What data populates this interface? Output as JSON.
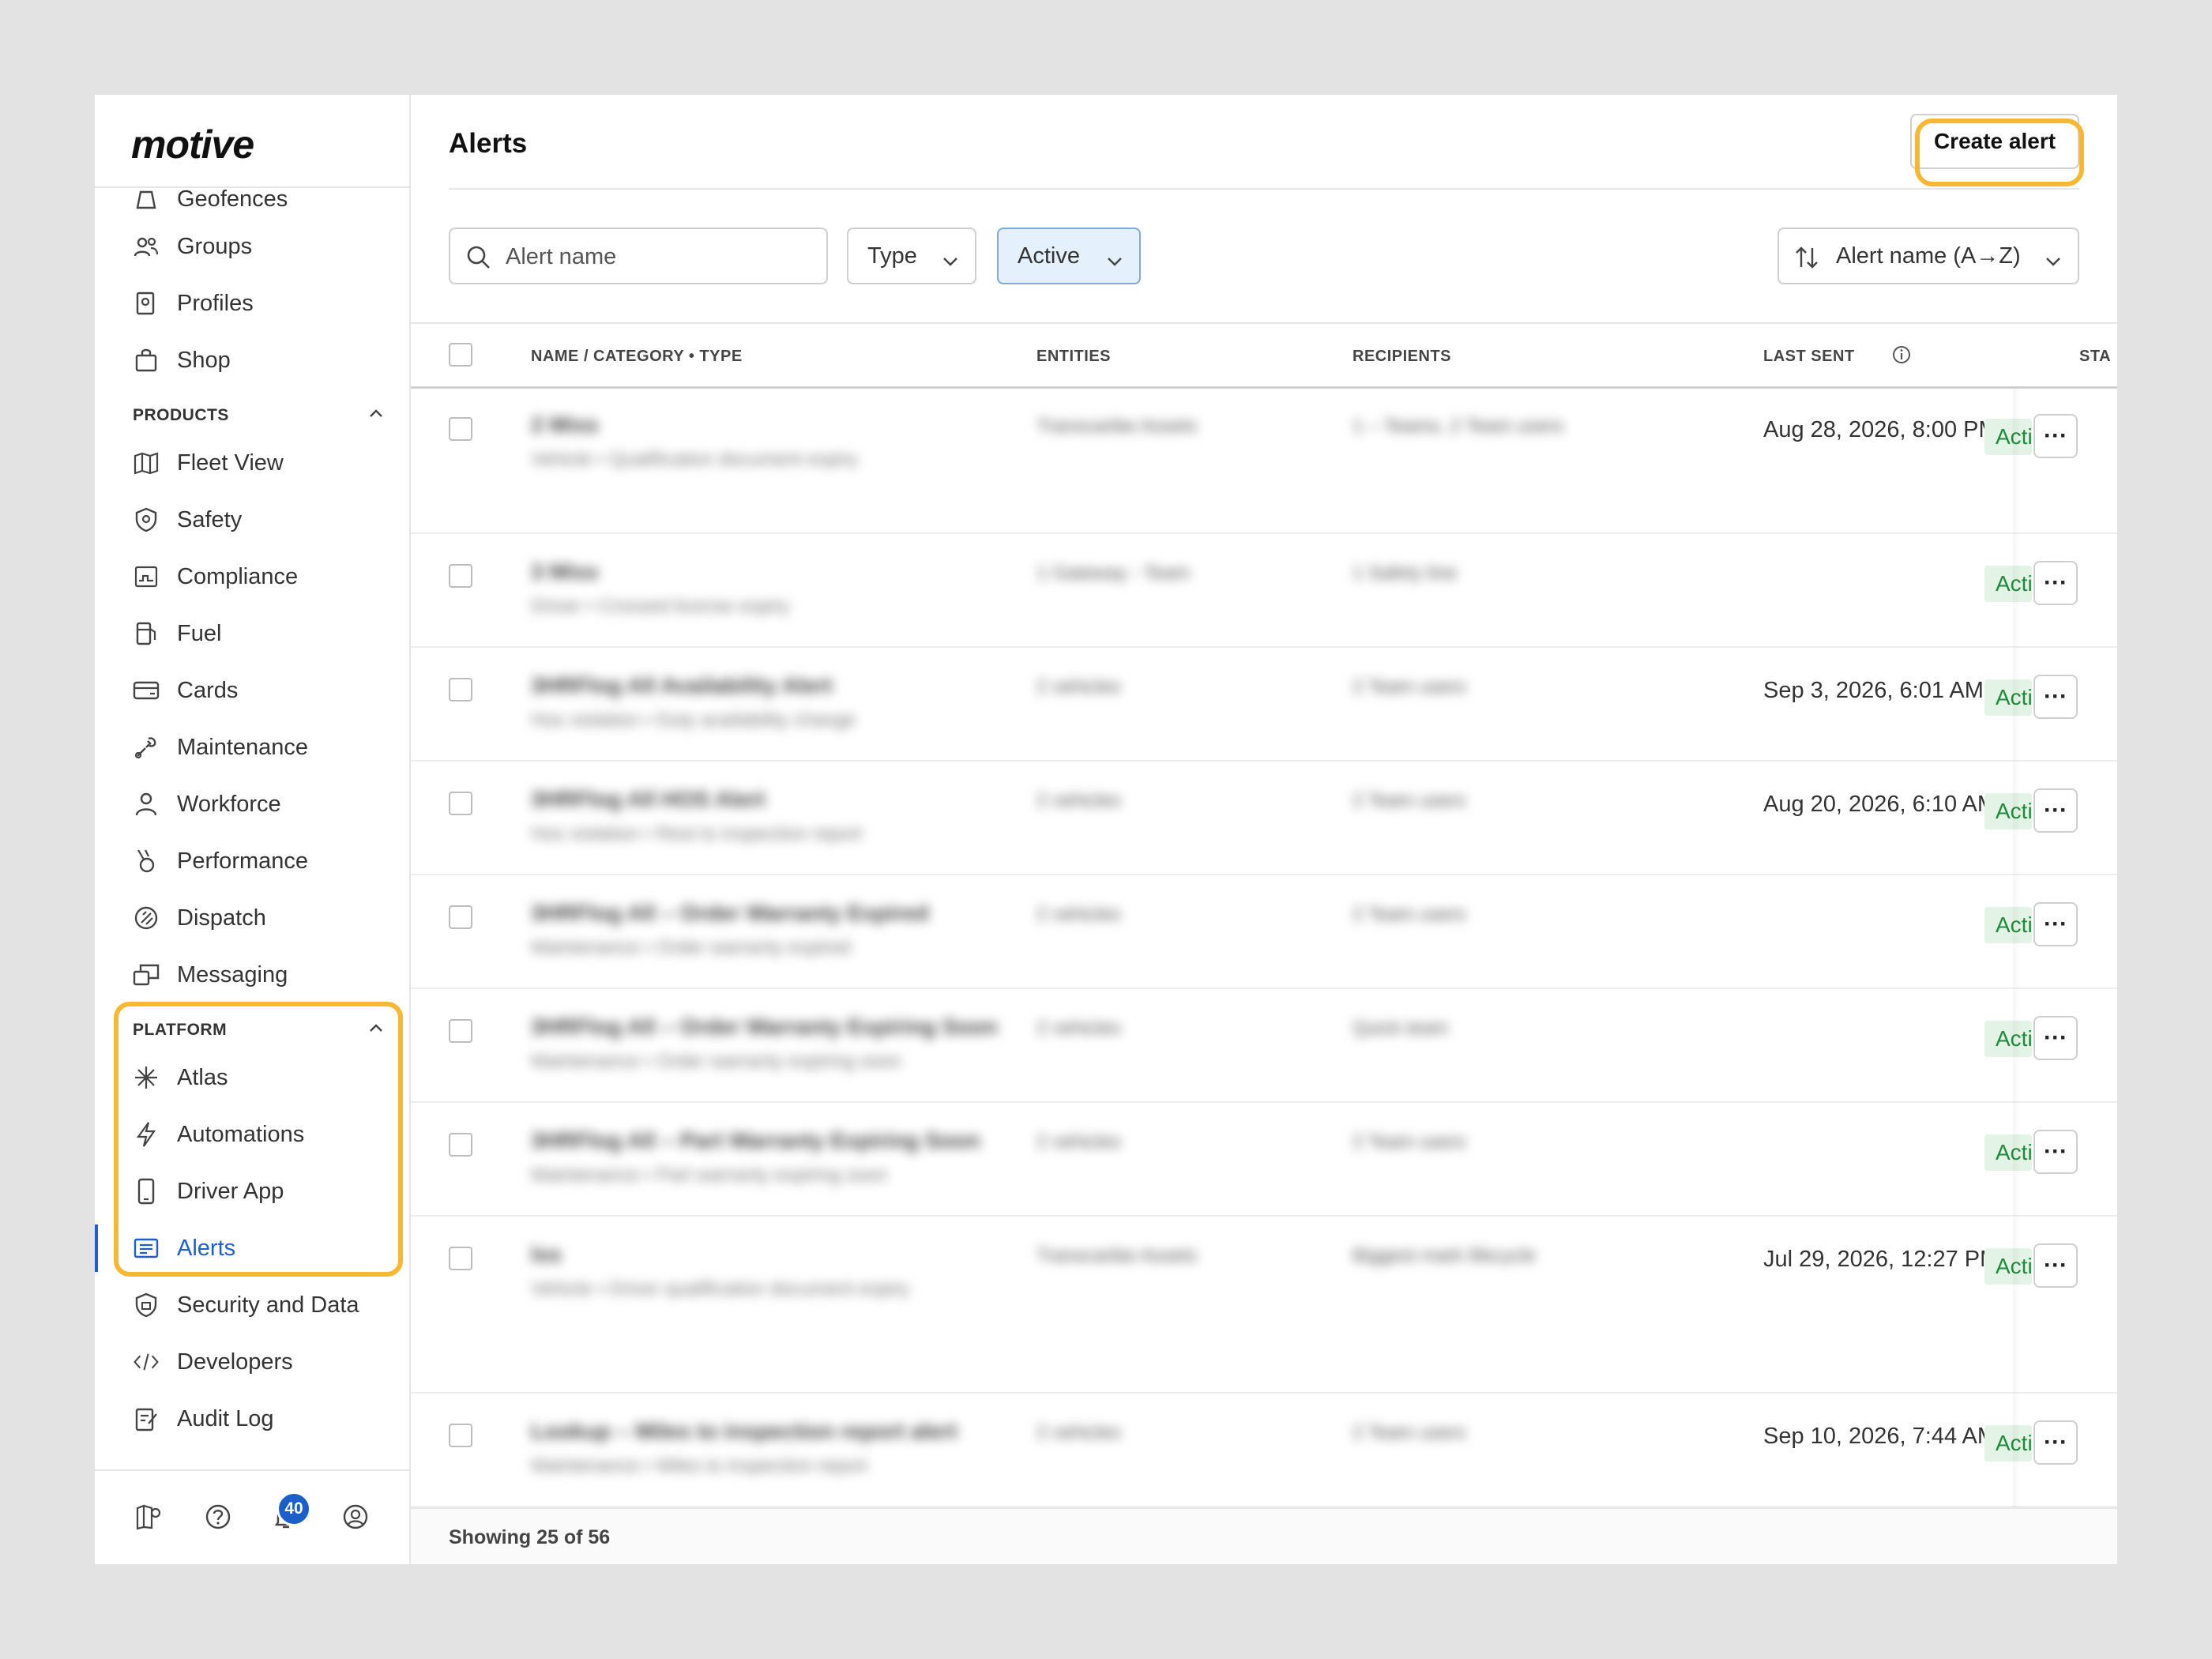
{
  "brand": {
    "logo": "motive"
  },
  "sidebar": {
    "top_items": [
      {
        "label": "Geofences",
        "icon": "geofence-icon"
      },
      {
        "label": "Groups",
        "icon": "groups-icon"
      },
      {
        "label": "Profiles",
        "icon": "profiles-icon"
      },
      {
        "label": "Shop",
        "icon": "shop-icon"
      }
    ],
    "products_label": "PRODUCTS",
    "products": [
      {
        "label": "Fleet View",
        "icon": "map-icon"
      },
      {
        "label": "Safety",
        "icon": "shield-icon"
      },
      {
        "label": "Compliance",
        "icon": "compliance-icon"
      },
      {
        "label": "Fuel",
        "icon": "fuel-icon"
      },
      {
        "label": "Cards",
        "icon": "card-icon"
      },
      {
        "label": "Maintenance",
        "icon": "wrench-icon"
      },
      {
        "label": "Workforce",
        "icon": "person-icon"
      },
      {
        "label": "Performance",
        "icon": "medal-icon"
      },
      {
        "label": "Dispatch",
        "icon": "dispatch-icon"
      },
      {
        "label": "Messaging",
        "icon": "messaging-icon"
      }
    ],
    "platform_label": "PLATFORM",
    "platform": [
      {
        "label": "Atlas",
        "icon": "sparkle-icon"
      },
      {
        "label": "Automations",
        "icon": "lightning-icon"
      },
      {
        "label": "Driver App",
        "icon": "phone-icon"
      },
      {
        "label": "Alerts",
        "icon": "alerts-icon",
        "active": true
      }
    ],
    "other": [
      {
        "label": "Security and Data",
        "icon": "lock-shield-icon"
      },
      {
        "label": "Developers",
        "icon": "code-icon"
      },
      {
        "label": "Audit Log",
        "icon": "audit-icon"
      }
    ],
    "footer": {
      "notification_count": "40"
    }
  },
  "header": {
    "title": "Alerts",
    "create_button": "Create alert"
  },
  "filters": {
    "search_placeholder": "Alert name",
    "type_label": "Type",
    "status_label": "Active",
    "sort_label": "Alert name (A→Z)"
  },
  "table": {
    "columns": [
      "NAME / CATEGORY • TYPE",
      "ENTITIES",
      "RECIPIENTS",
      "LAST SENT",
      "STA"
    ],
    "rows": [
      {
        "name": "2 Miss",
        "category": "Vehicle • Qualification document expiry",
        "entities": "Transcaribe Assets",
        "recipients": "1 – Teams, 2 Team users",
        "last_sent": "Aug 28, 2026, 8:00 PM",
        "status": "Active"
      },
      {
        "name": "3 Miss",
        "category": "Driver • Crossed license expiry",
        "entities": "1 Gateway - Team",
        "recipients": "1 Safety line",
        "last_sent": "",
        "status": "Active"
      },
      {
        "name": "3HRFlog All Availability Alert",
        "category": "Hos violation • Duty availability change",
        "entities": "2 vehicles",
        "recipients": "2 Team users",
        "last_sent": "Sep 3, 2026, 6:01 AM",
        "status": "Active"
      },
      {
        "name": "3HRFlog All HOS Alert",
        "category": "Hos violation • Rest to inspection report",
        "entities": "2 vehicles",
        "recipients": "2 Team users",
        "last_sent": "Aug 20, 2026, 6:10 AM",
        "status": "Active"
      },
      {
        "name": "3HRFlog All – Order Warranty Expired",
        "category": "Maintenance • Order warranty expired",
        "entities": "2 vehicles",
        "recipients": "2 Team users",
        "last_sent": "",
        "status": "Active"
      },
      {
        "name": "3HRFlog All – Order Warranty Expiring Soon",
        "category": "Maintenance • Order warranty expiring soon",
        "entities": "2 vehicles",
        "recipients": "Quick team",
        "last_sent": "",
        "status": "Active"
      },
      {
        "name": "3HRFlog All – Part Warranty Expiring Soon",
        "category": "Maintenance • Part warranty expiring soon",
        "entities": "2 vehicles",
        "recipients": "2 Team users",
        "last_sent": "",
        "status": "Active"
      },
      {
        "name": "Iss",
        "category": "Vehicle • Driver qualification document expiry",
        "entities": "Transcaribe Assets",
        "recipients": "Biggest mark lifecycle",
        "last_sent": "Jul 29, 2026, 12:27 PM",
        "status": "Active"
      },
      {
        "name": "Lookup – Miles to inspection report alert",
        "category": "Maintenance • Miles to inspection report",
        "entities": "2 vehicles",
        "recipients": "2 Team users",
        "last_sent": "Sep 10, 2026, 7:44 AM",
        "status": "Active"
      }
    ]
  },
  "footer": {
    "showing": "Showing 25 of 56"
  }
}
